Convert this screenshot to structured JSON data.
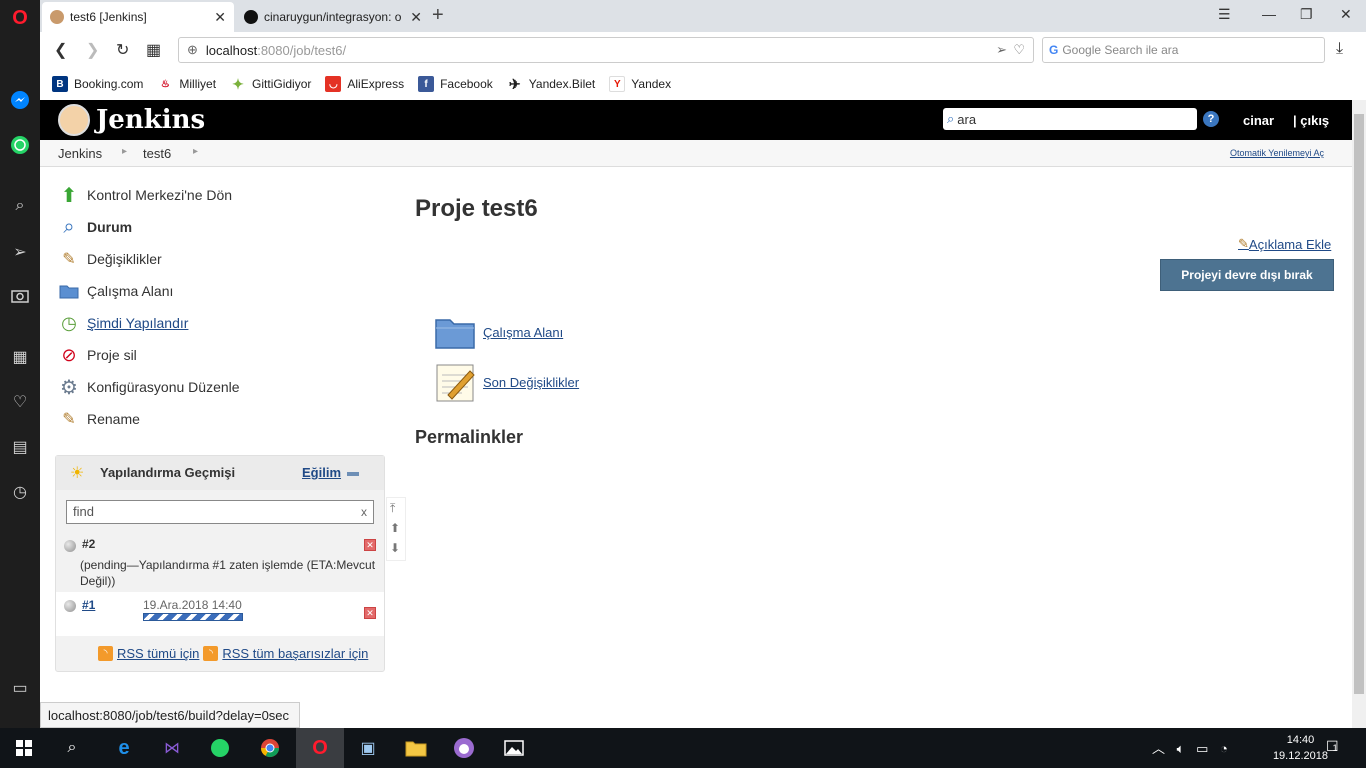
{
  "browser": {
    "tabs": [
      {
        "title": "test6 [Jenkins]",
        "close": "✕"
      },
      {
        "title": "cinaruygun/integrasyon: o",
        "close": "✕"
      }
    ],
    "new_tab": "+",
    "url_host": "localhost",
    "url_path": ":8080/job/test6/",
    "search_placeholder": "Google Search ile ara",
    "bookmarks": [
      {
        "label": "Booking.com",
        "icon": "booking-icon",
        "color": "#003580"
      },
      {
        "label": "Milliyet",
        "icon": "milliyet-icon",
        "color": "#d0021b"
      },
      {
        "label": "GittiGidiyor",
        "icon": "gittigidiyor-icon",
        "color": "#7bb13c"
      },
      {
        "label": "AliExpress",
        "icon": "aliexpress-icon",
        "color": "#e43225"
      },
      {
        "label": "Facebook",
        "icon": "facebook-icon",
        "color": "#3b5998"
      },
      {
        "label": "Yandex.Bilet",
        "icon": "yandex-bilet-icon",
        "color": "#222222"
      },
      {
        "label": "Yandex",
        "icon": "yandex-icon",
        "color": "#e61400"
      }
    ],
    "status_url": "localhost:8080/job/test6/build?delay=0sec"
  },
  "jenkins": {
    "logo_text": "Jenkins",
    "search_value": "ara",
    "help": "?",
    "user": "cinar",
    "logout": "| çıkış",
    "breadcrumb": [
      "Jenkins",
      "test6"
    ],
    "auto_refresh": "Otomatik Yenilemeyi Aç",
    "tasks": [
      {
        "label": "Kontrol Merkezi'ne Dön",
        "icon": "up-arrow-icon"
      },
      {
        "label": "Durum",
        "icon": "search-icon"
      },
      {
        "label": "Değişiklikler",
        "icon": "notepad-icon"
      },
      {
        "label": "Çalışma Alanı",
        "icon": "folder-icon"
      },
      {
        "label": "Şimdi Yapılandır",
        "icon": "clock-build-icon"
      },
      {
        "label": "Proje sil",
        "icon": "no-entry-icon"
      },
      {
        "label": "Konfigürasyonu Düzenle",
        "icon": "gear-icon"
      },
      {
        "label": "Rename",
        "icon": "notepad-icon"
      }
    ],
    "history": {
      "title": "Yapılandırma Geçmişi",
      "trend": "Eğilim",
      "find_placeholder": "find",
      "find_clear": "x",
      "builds": [
        {
          "number": "#2",
          "detail": "(pending—Yapılandırma #1 zaten işlemde (ETA:Mevcut Değil))"
        },
        {
          "number": "#1",
          "date": "19.Ara.2018 14:40"
        }
      ],
      "rss_all": "RSS tümü için",
      "rss_failures": "RSS tüm başarısızlar için"
    },
    "main": {
      "title": "Proje test6",
      "add_description": "Açıklama Ekle",
      "disable_button": "Projeyi devre dışı bırak",
      "links": [
        {
          "label": "Çalışma Alanı",
          "icon": "folder-icon"
        },
        {
          "label": "Son Değişiklikler",
          "icon": "notepad-icon"
        }
      ],
      "permalinks": "Permalinkler"
    }
  },
  "taskbar": {
    "time": "14:40",
    "date": "19.12.2018",
    "notification_count": "1"
  }
}
